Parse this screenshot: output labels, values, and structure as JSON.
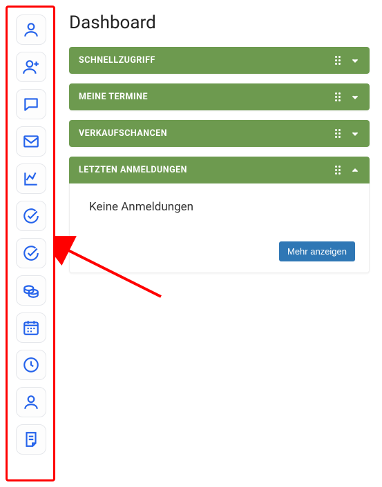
{
  "title": "Dashboard",
  "sidebar": {
    "items": [
      {
        "name": "user-icon"
      },
      {
        "name": "add-user-icon"
      },
      {
        "name": "chat-icon"
      },
      {
        "name": "mail-icon"
      },
      {
        "name": "chart-icon"
      },
      {
        "name": "check-circle-icon"
      },
      {
        "name": "check-circle-icon-2"
      },
      {
        "name": "coins-icon"
      },
      {
        "name": "calendar-icon"
      },
      {
        "name": "clock-icon"
      },
      {
        "name": "user-icon-2"
      },
      {
        "name": "note-icon"
      }
    ]
  },
  "panels": [
    {
      "label": "SCHNELLZUGRIFF",
      "expanded": false
    },
    {
      "label": "MEINE TERMINE",
      "expanded": false
    },
    {
      "label": "VERKAUFSCHANCEN",
      "expanded": false
    },
    {
      "label": "LETZTEN ANMELDUNGEN",
      "expanded": true,
      "empty_msg": "Keine Anmeldungen",
      "more_label": "Mehr anzeigen"
    }
  ]
}
